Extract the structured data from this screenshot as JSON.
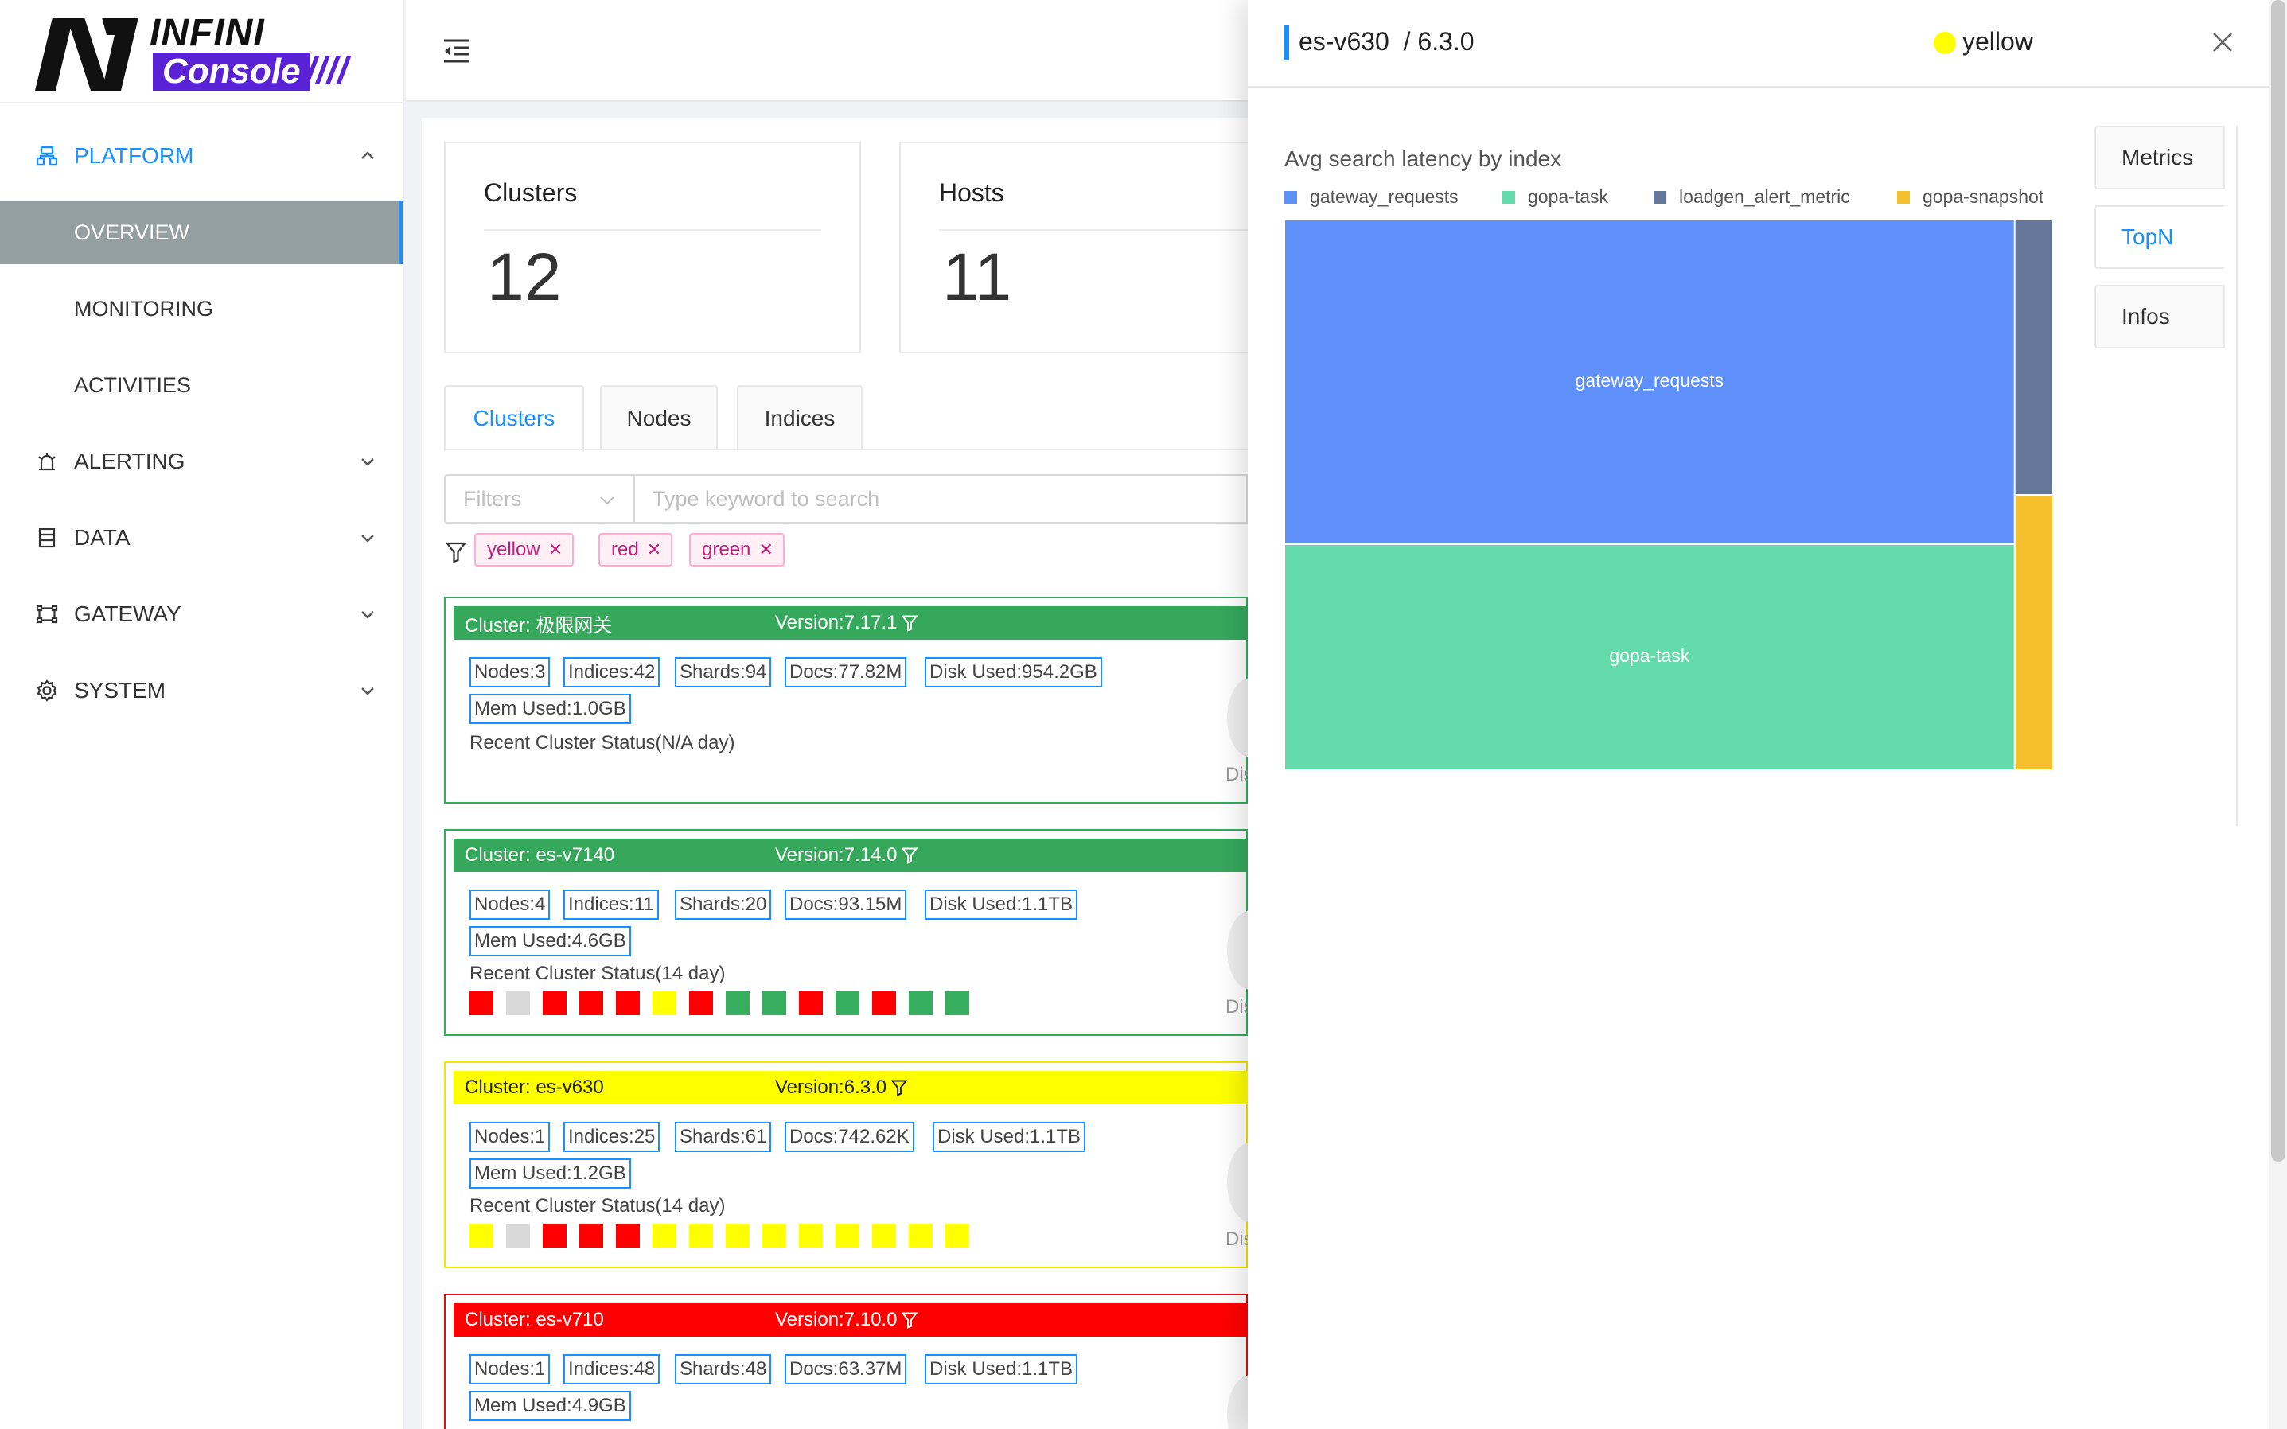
{
  "brand": {
    "top": "INFINI",
    "bottom": "Console",
    "slashes": "////"
  },
  "sidebar": {
    "sections": [
      {
        "label": "PLATFORM",
        "icon": "platform-icon",
        "expanded": true
      },
      {
        "label": "ALERTING",
        "icon": "alarm-icon",
        "expanded": false
      },
      {
        "label": "DATA",
        "icon": "database-icon",
        "expanded": false
      },
      {
        "label": "GATEWAY",
        "icon": "gateway-icon",
        "expanded": false
      },
      {
        "label": "SYSTEM",
        "icon": "gear-icon",
        "expanded": false
      }
    ],
    "platform_items": [
      "OVERVIEW",
      "MONITORING",
      "ACTIVITIES"
    ],
    "selected": "OVERVIEW",
    "accent": "#1890ff"
  },
  "stats": {
    "clusters": {
      "label": "Clusters",
      "value": "12"
    },
    "hosts": {
      "label": "Hosts",
      "value": "11"
    }
  },
  "tabs": {
    "items": [
      "Clusters",
      "Nodes",
      "Indices"
    ],
    "active": "Clusters"
  },
  "filters": {
    "select_placeholder": "Filters",
    "search_placeholder": "Type keyword to search",
    "tags": [
      "yellow",
      "red",
      "green"
    ]
  },
  "clusters": [
    {
      "status": "green",
      "name": "Cluster: 极限网关",
      "version": "Version:7.17.1",
      "badges": [
        "Nodes:3",
        "Indices:42",
        "Shards:94",
        "Docs:77.82M",
        "Disk Used:954.2GB",
        "Mem Used:1.0GB"
      ],
      "recent": "Recent Cluster Status(N/A day)",
      "days": [],
      "dis": "Dis"
    },
    {
      "status": "green",
      "name": "Cluster: es-v7140",
      "version": "Version:7.14.0",
      "badges": [
        "Nodes:4",
        "Indices:11",
        "Shards:20",
        "Docs:93.15M",
        "Disk Used:1.1TB",
        "Mem Used:4.6GB"
      ],
      "recent": "Recent Cluster Status(14 day)",
      "days": [
        "red",
        "gray",
        "red",
        "red",
        "red",
        "yellow",
        "red",
        "green",
        "green",
        "red",
        "green",
        "red",
        "green",
        "green"
      ],
      "dis": "Dis"
    },
    {
      "status": "yellow",
      "name": "Cluster: es-v630",
      "version": "Version:6.3.0",
      "badges": [
        "Nodes:1",
        "Indices:25",
        "Shards:61",
        "Docs:742.62K",
        "Disk Used:1.1TB",
        "Mem Used:1.2GB"
      ],
      "recent": "Recent Cluster Status(14 day)",
      "days": [
        "yellow",
        "gray",
        "red",
        "red",
        "red",
        "yellow",
        "yellow",
        "yellow",
        "yellow",
        "yellow",
        "yellow",
        "yellow",
        "yellow",
        "yellow"
      ],
      "dis": "Dis"
    },
    {
      "status": "red",
      "name": "Cluster: es-v710",
      "version": "Version:7.10.0",
      "badges": [
        "Nodes:1",
        "Indices:48",
        "Shards:48",
        "Docs:63.37M",
        "Disk Used:1.1TB",
        "Mem Used:4.9GB"
      ],
      "recent": "",
      "days": [],
      "dis": ""
    }
  ],
  "status_colors": {
    "green": "#37ae5e",
    "red": "#ff0000",
    "yellow": "#ffff00",
    "gray": "#d9d9d9"
  },
  "drawer": {
    "name": "es-v630",
    "version": "/ 6.3.0",
    "status": "yellow",
    "side_tabs": [
      "Metrics",
      "TopN",
      "Infos"
    ],
    "active_side_tab": "TopN"
  },
  "chart_data": {
    "type": "treemap",
    "title": "Avg search latency by index",
    "series": [
      {
        "name": "gateway_requests",
        "value": 56,
        "color": "#5f8ff8"
      },
      {
        "name": "gopa-task",
        "value": 39,
        "color": "#62daaa"
      },
      {
        "name": "loadgen_alert_metric",
        "value": 2.5,
        "color": "#65789b"
      },
      {
        "name": "gopa-snapshot",
        "value": 2.5,
        "color": "#f6c02d"
      }
    ],
    "legend_position": "top-left"
  }
}
